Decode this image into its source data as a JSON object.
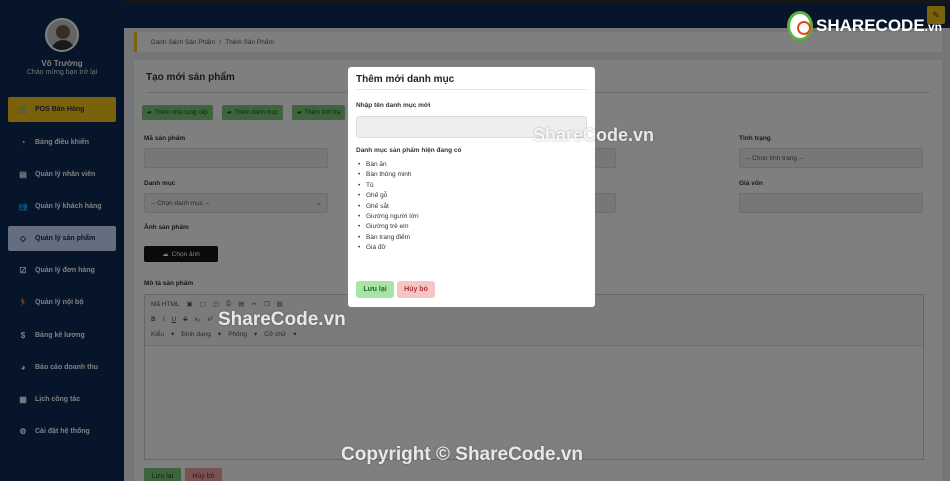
{
  "user": {
    "name": "Võ Trường",
    "greeting": "Chào mừng bạn trở lại"
  },
  "sidebar": {
    "items": [
      {
        "label": "POS Bán Hàng",
        "icon": "cart-icon"
      },
      {
        "label": "Bảng điều khiển",
        "icon": "dashboard-icon"
      },
      {
        "label": "Quản lý nhân viên",
        "icon": "id-card-icon"
      },
      {
        "label": "Quản lý khách hàng",
        "icon": "users-icon"
      },
      {
        "label": "Quản lý sản phẩm",
        "icon": "tag-icon"
      },
      {
        "label": "Quản lý đơn hàng",
        "icon": "clipboard-icon"
      },
      {
        "label": "Quản lý nội bộ",
        "icon": "runner-icon"
      },
      {
        "label": "Bảng kê lương",
        "icon": "dollar-icon"
      },
      {
        "label": "Báo cáo doanh thu",
        "icon": "pie-chart-icon"
      },
      {
        "label": "Lịch công tác",
        "icon": "calendar-icon"
      },
      {
        "label": "Cài đặt hệ thống",
        "icon": "gear-icon"
      }
    ]
  },
  "breadcrumb": {
    "parent": "Danh Sách Sản Phẩm",
    "current": "Thêm Sản Phẩm"
  },
  "page": {
    "title": "Tạo mới sản phẩm",
    "quick_buttons": [
      "Thêm nhà cung cấp",
      "Thêm danh mục",
      "Thêm tình trạ"
    ],
    "fields": {
      "product_code_label": "Mã sản phẩm",
      "status_label": "Tình trạng",
      "status_value": "-- Chọn tình trạng --",
      "category_label": "Danh mục",
      "category_value": "-- Chọn danh mục --",
      "cost_label": "Giá vốn",
      "image_label": "Ảnh sản phẩm",
      "choose_image": "Chọn ảnh",
      "description_label": "Mô tả sản phẩm"
    },
    "editor": {
      "source_label": "Mã HTML",
      "format_labels": [
        "Kiểu",
        "Định dạng",
        "Phông",
        "Cỡ chữ"
      ]
    },
    "save_label": "Lưu lại",
    "cancel_label": "Hủy bỏ"
  },
  "modal": {
    "title": "Thêm mới danh mục",
    "input_label": "Nhập tên danh mục mới",
    "input_value": "",
    "list_label": "Danh mục sản phẩm hiện đang có",
    "categories": [
      "Bàn ăn",
      "Bàn thông minh",
      "Tủ",
      "Ghế gỗ",
      "Ghế sắt",
      "Giường người lớn",
      "Giường trẻ em",
      "Bàn trang điểm",
      "Giá đỡ"
    ],
    "save_label": "Lưu lại",
    "cancel_label": "Hủy bỏ"
  },
  "watermarks": {
    "logo_main": "SHARECODE",
    "logo_suffix": ".vn",
    "mid": "ShareCode.vn",
    "center": "ShareCode.vn",
    "bottom": "Copyright © ShareCode.vn"
  }
}
